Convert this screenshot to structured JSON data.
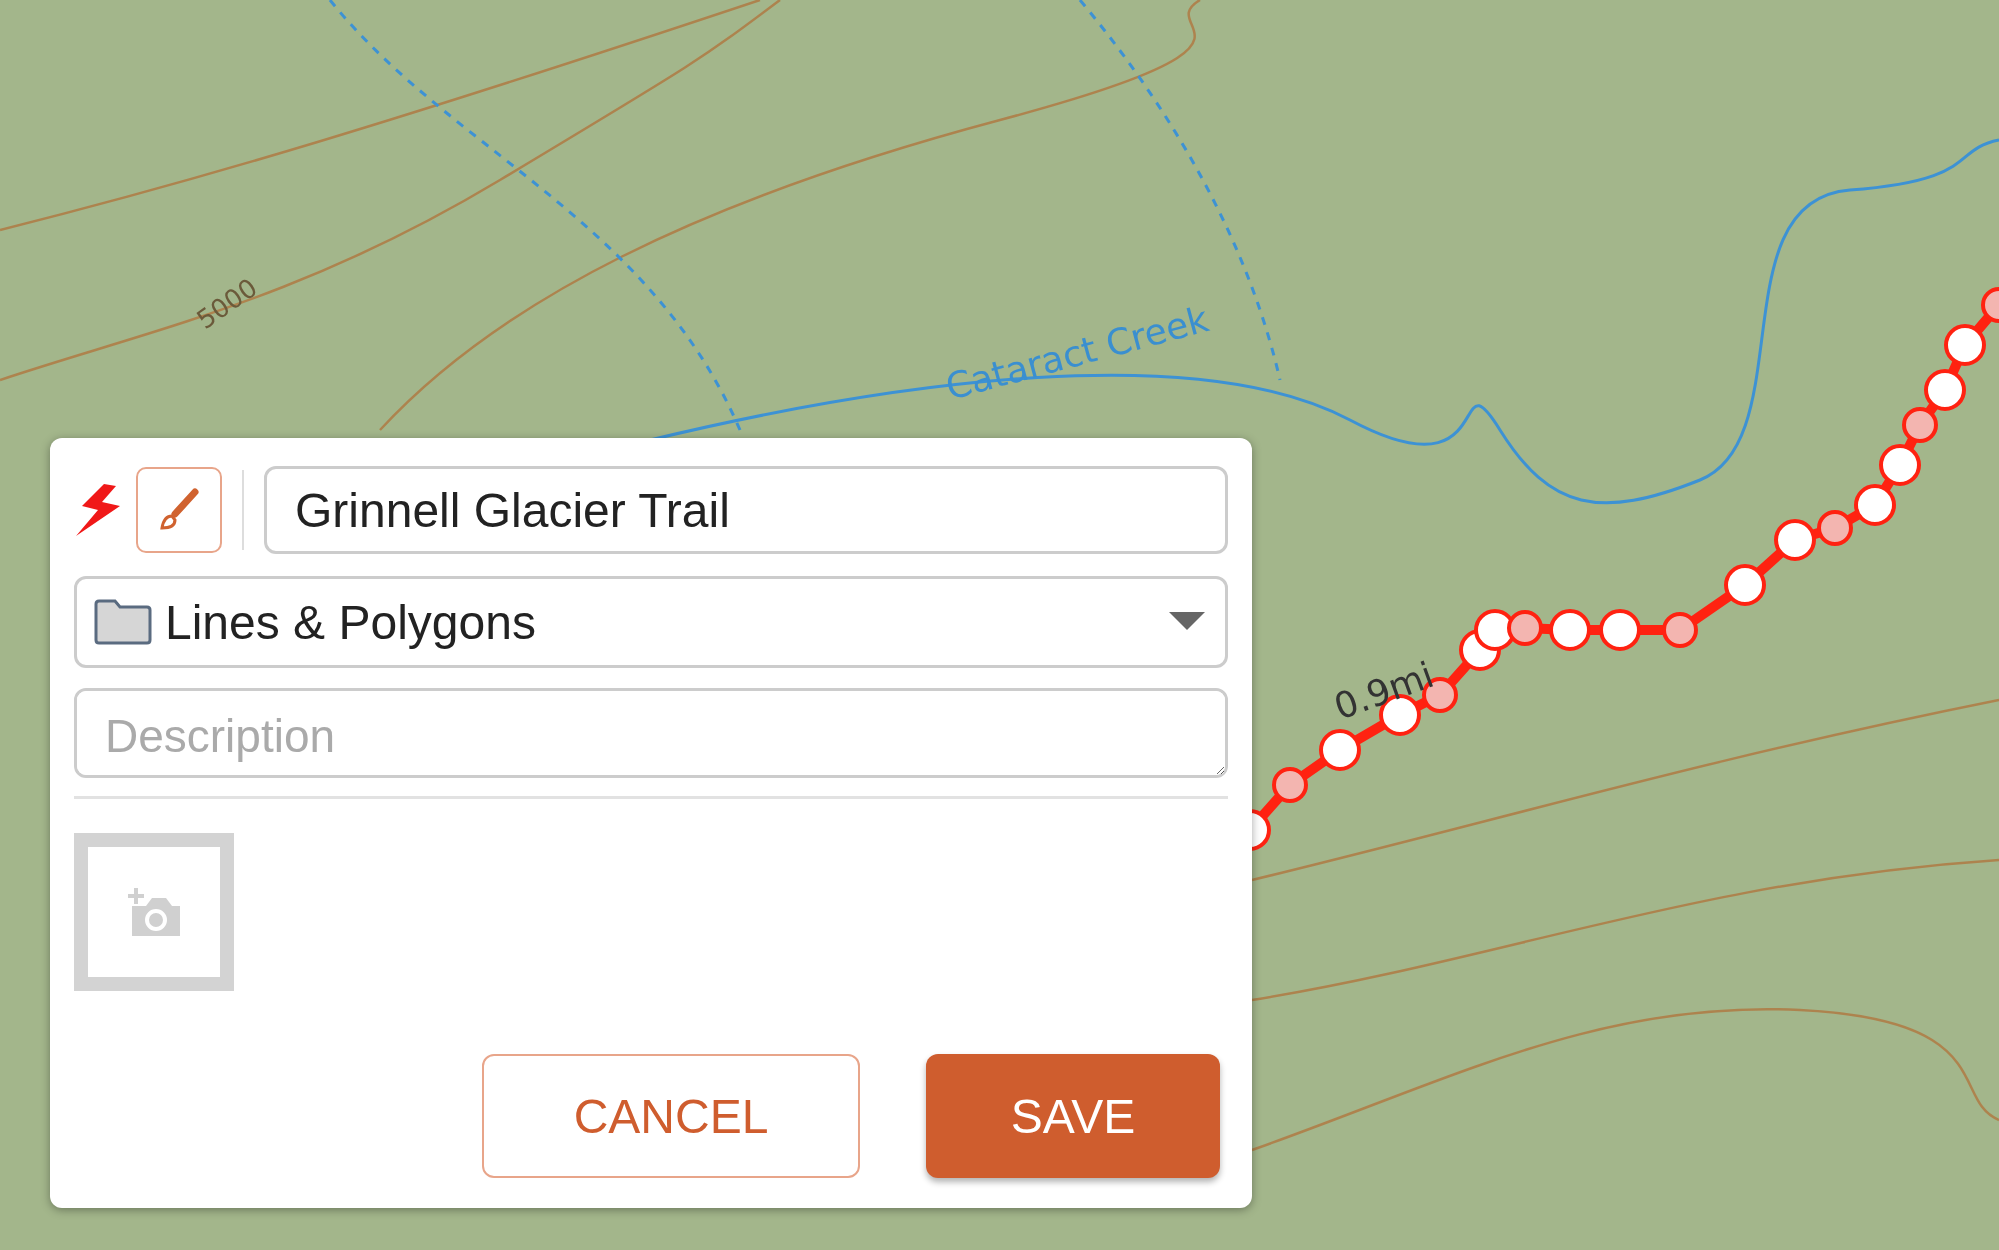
{
  "map": {
    "labels": [
      {
        "kind": "contour",
        "text": "5000"
      },
      {
        "kind": "water",
        "text": "Cataract Creek"
      },
      {
        "kind": "distance",
        "text": "0.9mi"
      }
    ]
  },
  "dialog": {
    "name_field": {
      "value": "Grinnell Glacier Trail"
    },
    "folder_select": {
      "value": "Lines & Polygons"
    },
    "description_field": {
      "placeholder": "Description"
    },
    "buttons": [
      {
        "kind": "secondary",
        "label": "CANCEL"
      },
      {
        "kind": "primary",
        "label": "SAVE"
      }
    ]
  }
}
